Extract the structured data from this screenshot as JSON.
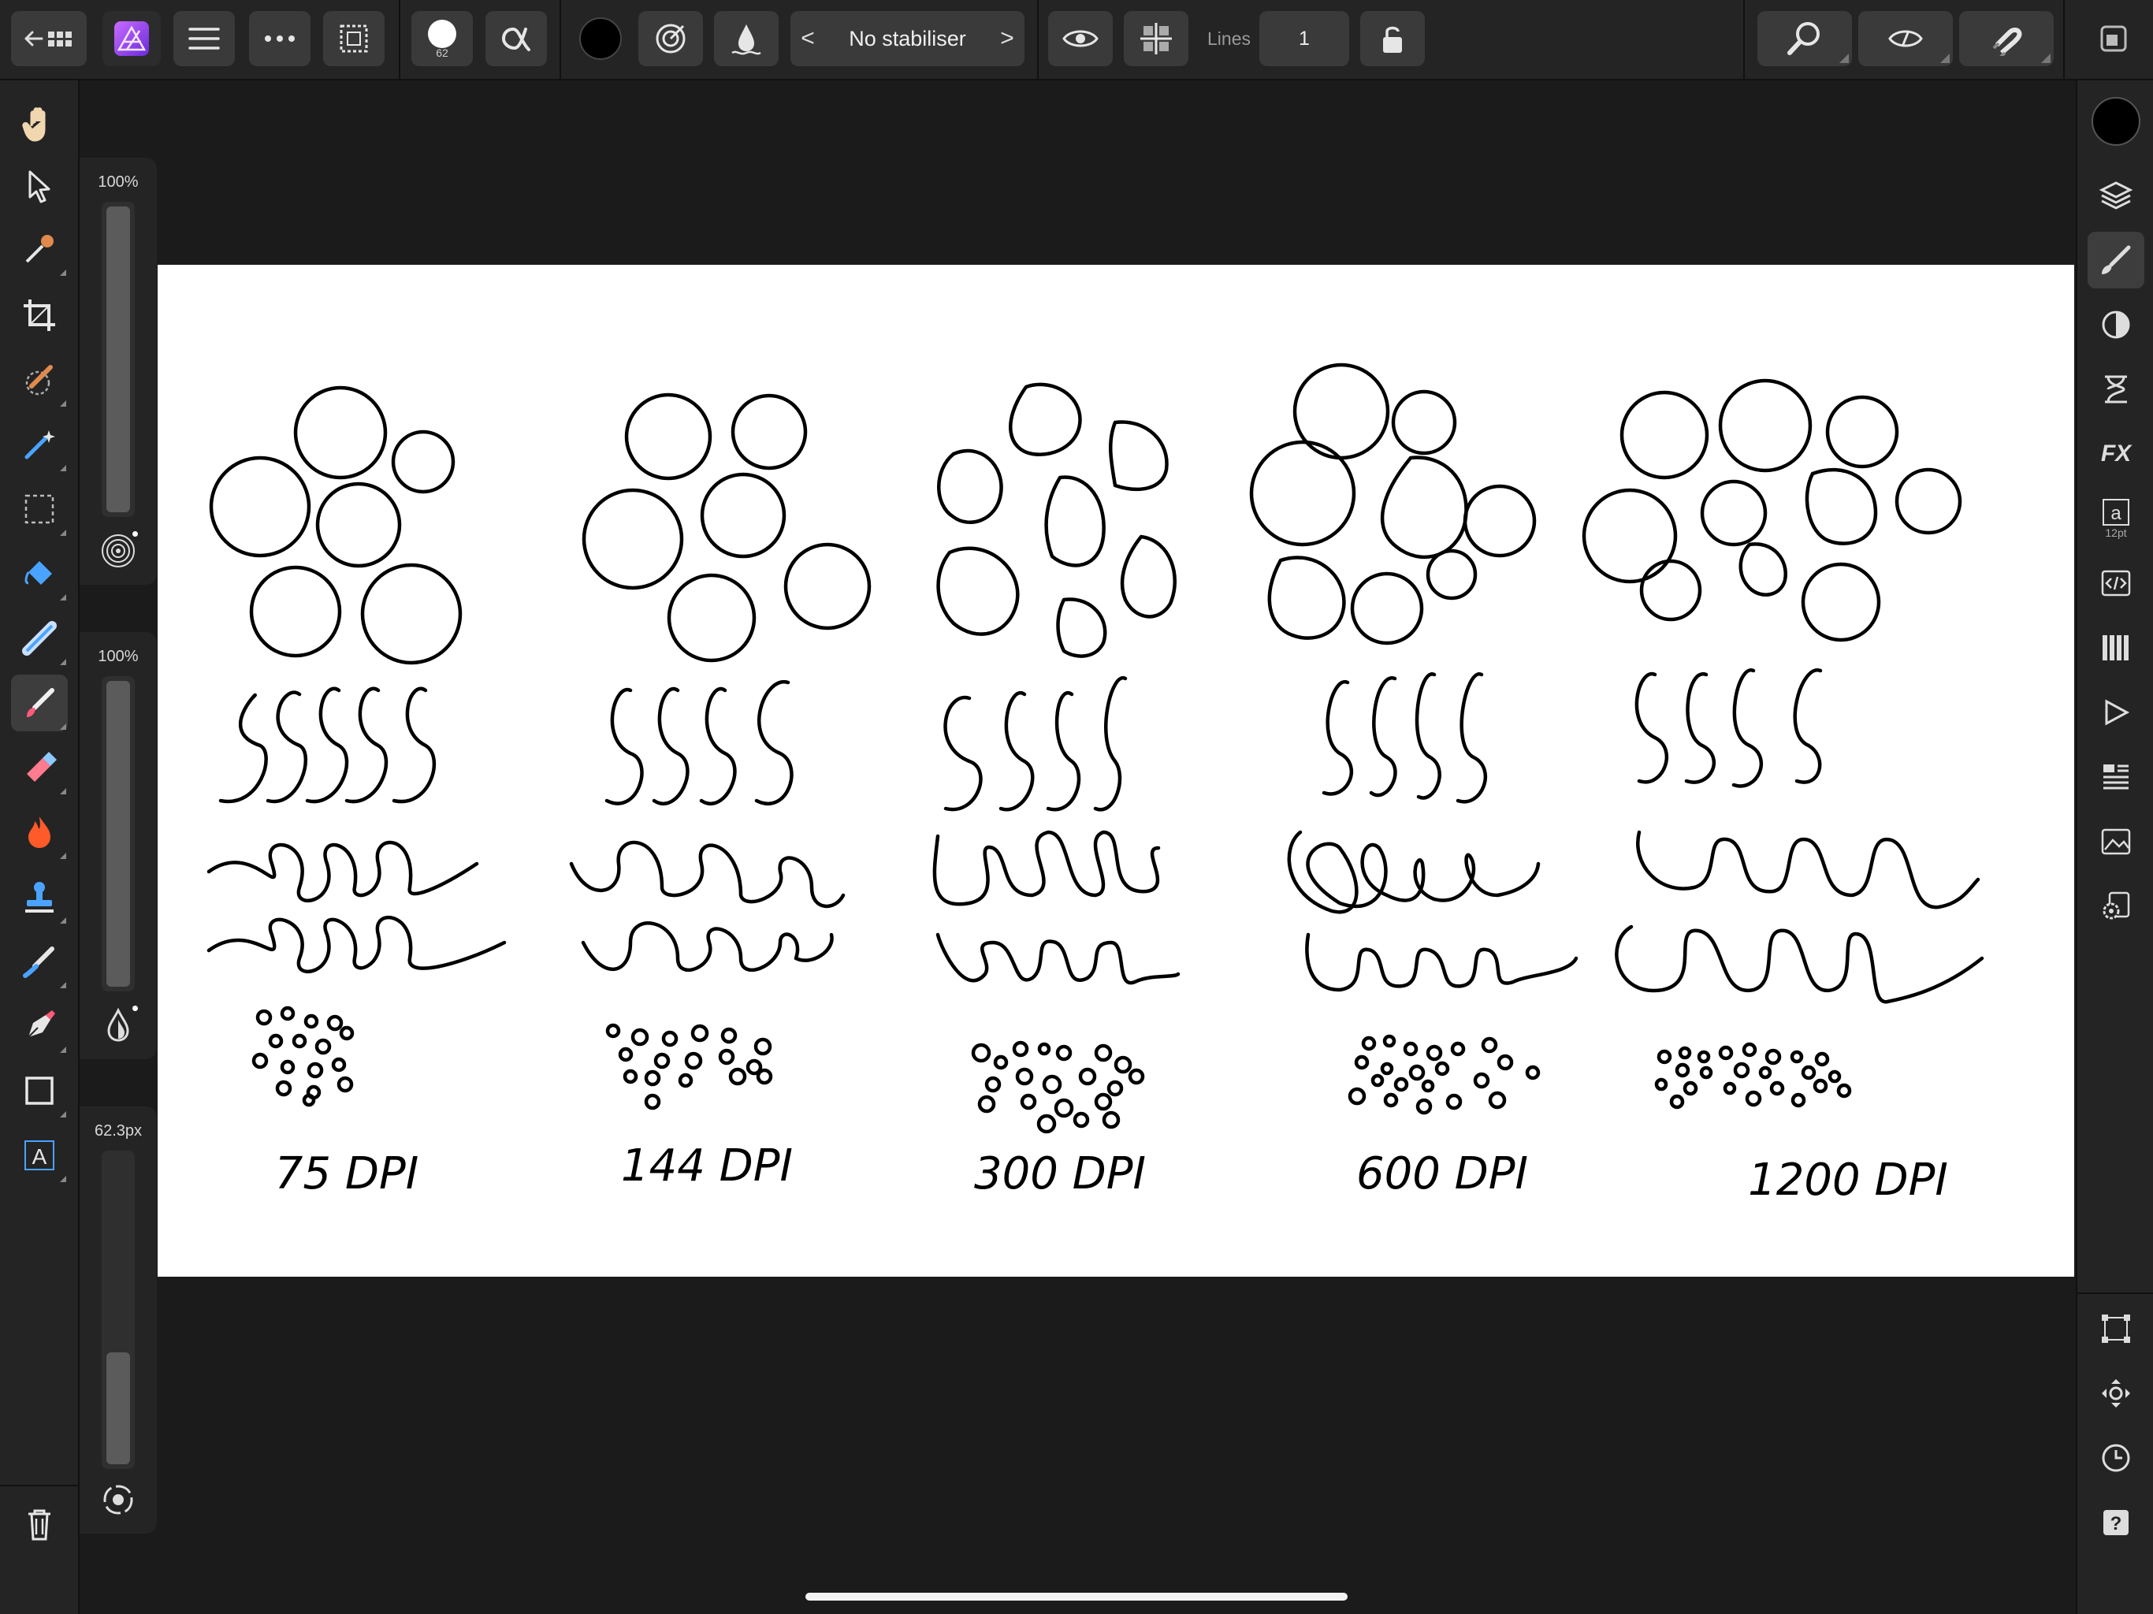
{
  "toolbar": {
    "brush_size": "62",
    "stabiliser_label": "No stabiliser",
    "stabiliser_prev": "<",
    "stabiliser_next": ">",
    "lines_label": "Lines",
    "lines_value": "1",
    "brush_color": "#000000",
    "accent": "#9b4dff"
  },
  "sliders": {
    "opacity_value": "100%",
    "opacity_level": 1.0,
    "flow_value": "100%",
    "flow_level": 1.0,
    "size_value": "62.3px",
    "size_level": 0.38
  },
  "left_tools": [
    {
      "name": "view-tool",
      "icon": "hand-icon"
    },
    {
      "name": "move-tool",
      "icon": "pointer-icon"
    },
    {
      "name": "color-picker-tool",
      "icon": "eyedropper-icon"
    },
    {
      "name": "crop-tool",
      "icon": "crop-icon"
    },
    {
      "name": "selection-brush-tool",
      "icon": "selection-brush-icon"
    },
    {
      "name": "magic-wand-tool",
      "icon": "magic-wand-icon"
    },
    {
      "name": "marquee-tool",
      "icon": "marquee-icon"
    },
    {
      "name": "flood-fill-tool",
      "icon": "paint-bucket-icon"
    },
    {
      "name": "gradient-tool",
      "icon": "gradient-icon"
    },
    {
      "name": "paint-brush-tool",
      "icon": "paint-brush-icon"
    },
    {
      "name": "erase-brush-tool",
      "icon": "eraser-icon"
    },
    {
      "name": "dodge-burn-tool",
      "icon": "flame-icon"
    },
    {
      "name": "clone-tool",
      "icon": "stamp-icon"
    },
    {
      "name": "smudge-tool",
      "icon": "smudge-icon"
    },
    {
      "name": "pen-tool",
      "icon": "pen-icon"
    },
    {
      "name": "rectangle-tool",
      "icon": "rectangle-icon"
    },
    {
      "name": "text-tool",
      "icon": "text-icon"
    }
  ],
  "right_panel": {
    "text_size_badge": "12pt",
    "fx_label": "FX"
  },
  "canvas": {
    "dpi_labels": [
      "75 DPI",
      "144 DPI",
      "300 DPI",
      "600 DPI",
      "1200 DPI"
    ]
  }
}
